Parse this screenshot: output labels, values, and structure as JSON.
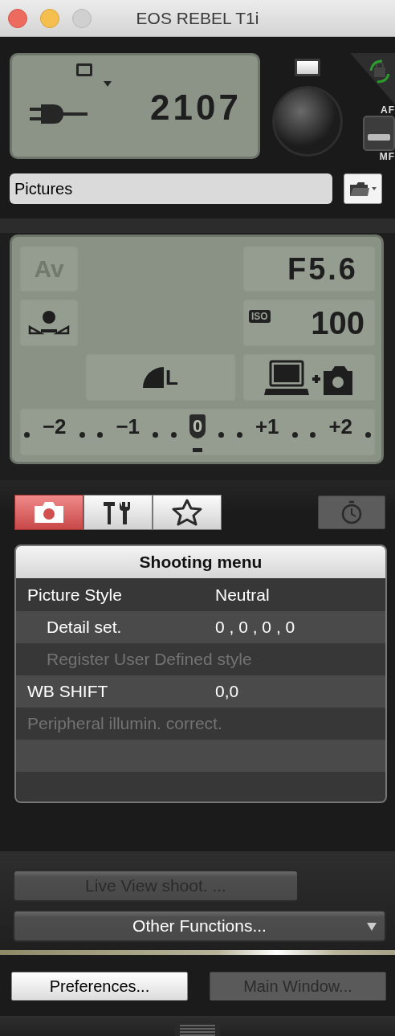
{
  "window": {
    "title": "EOS REBEL T1i"
  },
  "status_lcd": {
    "shots_remaining": "2107"
  },
  "af_switch": {
    "top_label": "AF",
    "bottom_label": "MF",
    "af_selected": true
  },
  "folder_field": {
    "value": "Pictures"
  },
  "settings_lcd": {
    "mode": {
      "text": "Av",
      "disabled": true
    },
    "aperture": "F5.6",
    "iso_label": "ISO",
    "iso": "100",
    "quality": "L",
    "exposure_scale": [
      {
        "label": "−2",
        "selected": false
      },
      {
        "label": "−1",
        "selected": false
      },
      {
        "label": "0",
        "selected": true
      },
      {
        "label": "+1",
        "selected": false
      },
      {
        "label": "+2",
        "selected": false
      }
    ]
  },
  "tabs": [
    {
      "kind": "camera",
      "selected": true
    },
    {
      "kind": "tools",
      "selected": false
    },
    {
      "kind": "star",
      "selected": false
    }
  ],
  "menu": {
    "title": "Shooting menu",
    "rows": [
      {
        "label": "Picture Style",
        "value": "Neutral",
        "disabled": false,
        "children": [
          {
            "label": "Detail set.",
            "value": "0 , 0 , 0 , 0",
            "disabled": false
          },
          {
            "label": "Register User Defined style",
            "disabled": true
          }
        ]
      },
      {
        "label": "WB SHIFT",
        "value": "0,0",
        "disabled": false
      },
      {
        "label": "Peripheral illumin. correct.",
        "disabled": true
      }
    ]
  },
  "buttons": {
    "live_view": {
      "label": "Live View shoot. ...",
      "disabled": true
    },
    "other_functions": {
      "label": "Other Functions..."
    },
    "preferences": {
      "label": "Preferences...",
      "disabled": false
    },
    "main_window": {
      "label": "Main Window...",
      "disabled": true
    }
  }
}
